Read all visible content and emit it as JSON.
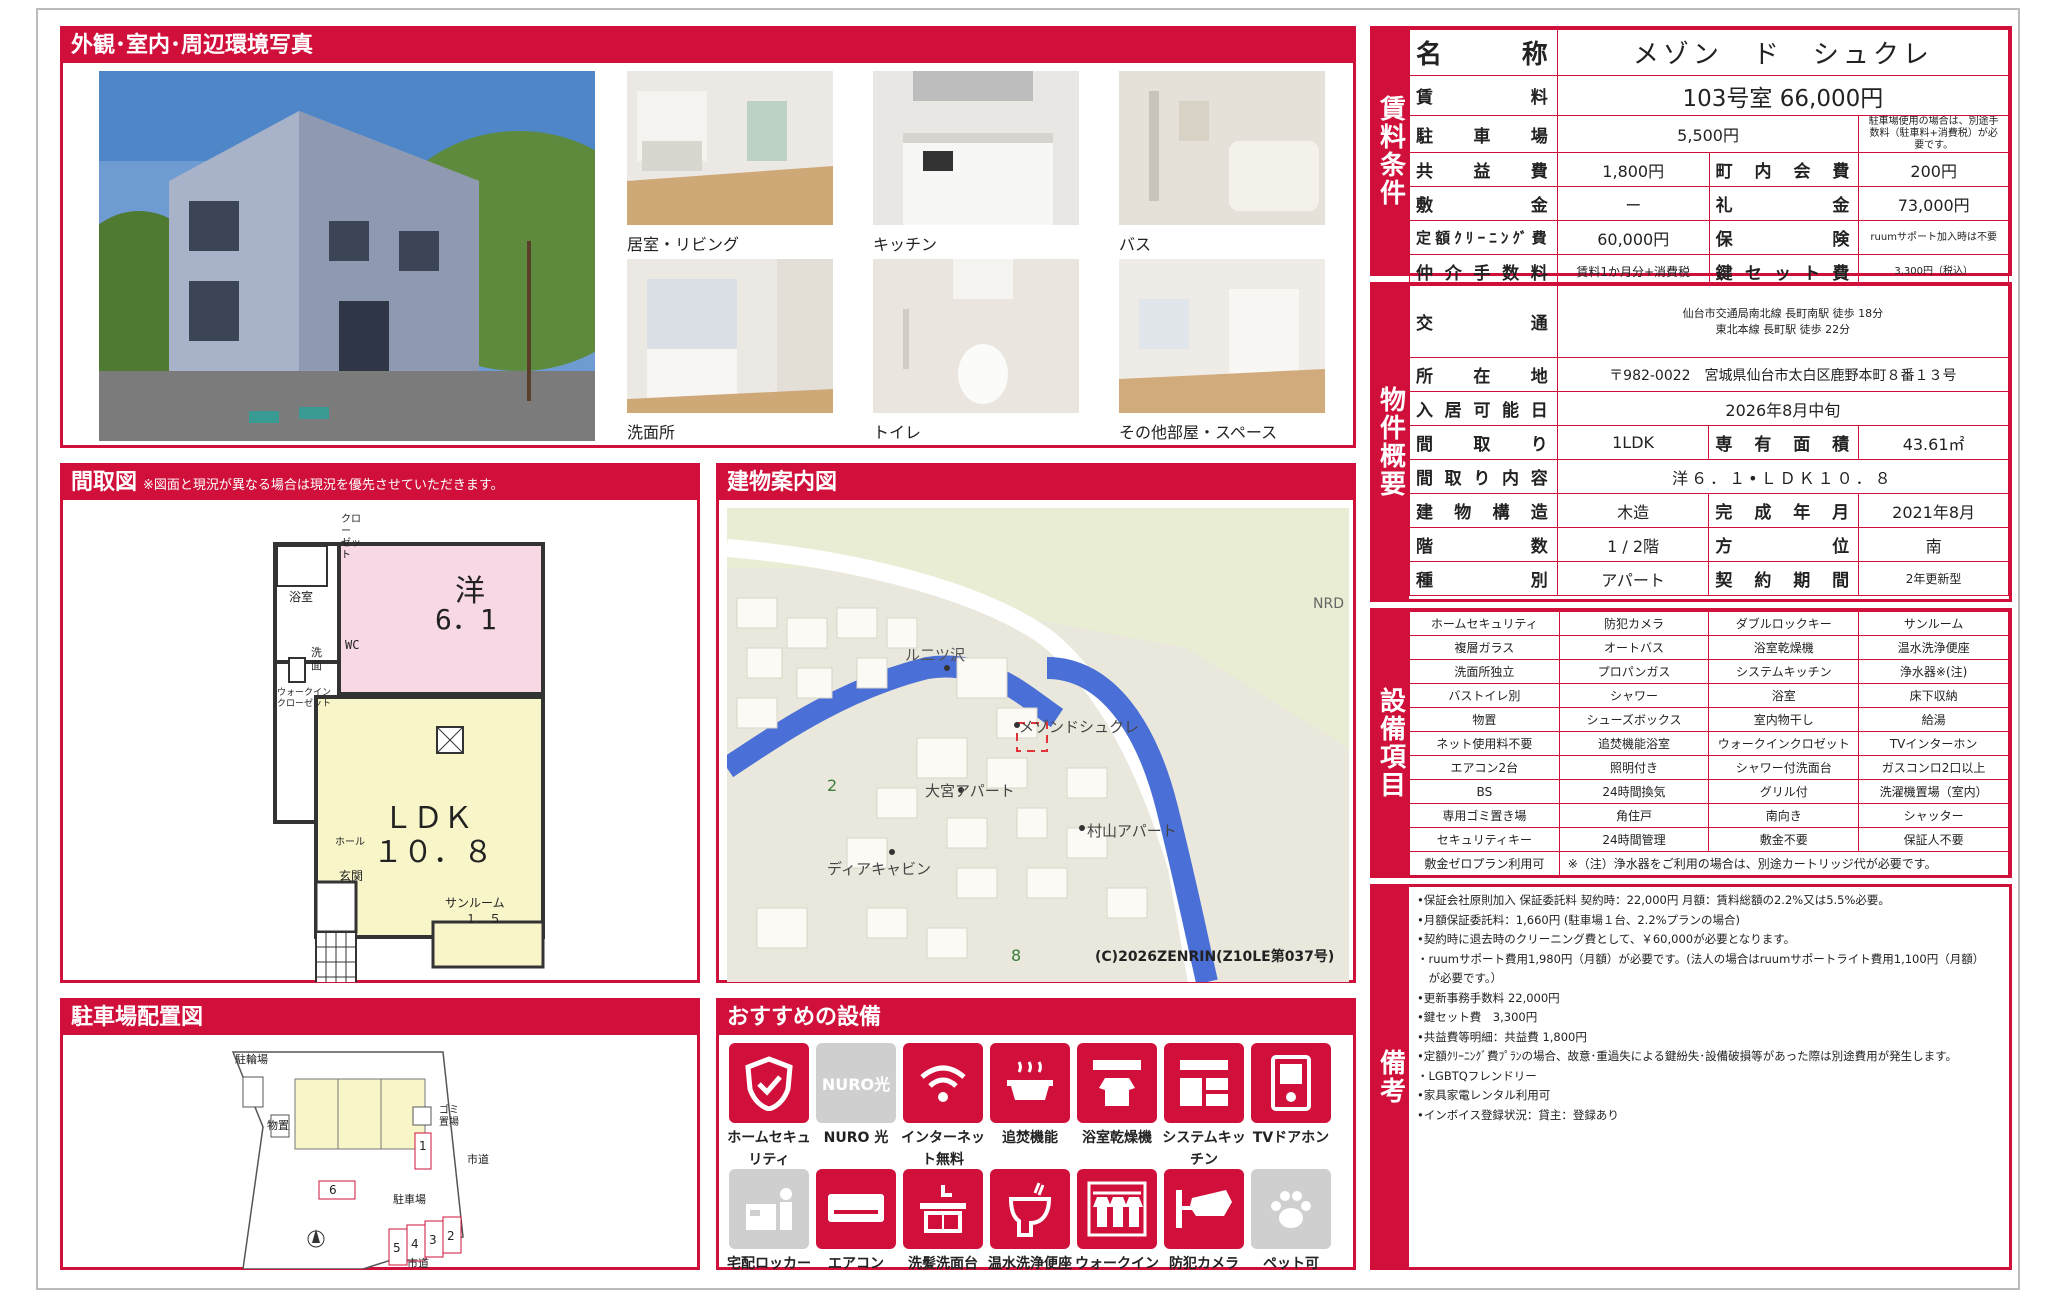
{
  "photos": {
    "header": "外観･室内･周辺環境写真",
    "captions": [
      "居室・リビング",
      "キッチン",
      "バス",
      "洗面所",
      "トイレ",
      "その他部屋・スペース"
    ]
  },
  "floorplan": {
    "header": "間取図",
    "note": "※図面と現況が異なる場合は現況を優先させていただきます。",
    "rooms": {
      "western": "洋",
      "western_size": "6．1",
      "ldk": "ＬＤＫ",
      "ldk_size": "１０．８",
      "bath": "浴室",
      "closet": "クロー ゼット",
      "washroom": "洗面",
      "wc": "WC",
      "walkin": "ウォークイン クローゼット",
      "hall": "ホール",
      "entrance": "玄関",
      "sunroom": "サンルーム",
      "sunroom_size": "１．５"
    }
  },
  "map": {
    "header": "建物案内図",
    "labels": [
      "ル二ツ沢",
      "メゾンドシュクレ",
      "大宮アパート",
      "村山アパート",
      "ディアキャビン",
      "2",
      "8",
      "NRD"
    ],
    "copyright": "(C)2026ZENRIN(Z10LE第037号)"
  },
  "parking": {
    "header": "駐車場配置図",
    "labels": {
      "bike": "駐輪場",
      "storage": "物置",
      "garbage": "ゴミ置場",
      "road1": "市道",
      "road2": "市道",
      "parking": "駐車場"
    },
    "spots": [
      "1",
      "2",
      "3",
      "4",
      "5",
      "6"
    ]
  },
  "equipment_icons": {
    "header": "おすすめの設備",
    "items": [
      {
        "label": "ホームセキュリティ",
        "state": "on"
      },
      {
        "label": "NURO 光",
        "state": "off",
        "icon_text": "NURO光"
      },
      {
        "label": "インターネット無料",
        "state": "on"
      },
      {
        "label": "追焚機能",
        "state": "on"
      },
      {
        "label": "浴室乾燥機",
        "state": "on"
      },
      {
        "label": "システムキッチン",
        "state": "on"
      },
      {
        "label": "TVドアホン",
        "state": "on"
      },
      {
        "label": "宅配ロッカー",
        "state": "off"
      },
      {
        "label": "エアコン",
        "state": "on"
      },
      {
        "label": "洗髪洗面台",
        "state": "on"
      },
      {
        "label": "温水洗浄便座",
        "state": "on"
      },
      {
        "label": "ウォークインクローゼット",
        "state": "on"
      },
      {
        "label": "防犯カメラ",
        "state": "on"
      },
      {
        "label": "ペット可",
        "state": "off"
      }
    ]
  },
  "rent": {
    "label": "賃料条件",
    "name_k": "名　称",
    "name": "メゾン　ド　シュクレ",
    "rent_k": "賃　料",
    "rent": "103号室 66,000円",
    "parking_k": "駐車場",
    "parking": "5,500円",
    "parking_note": "駐車場使用の場合は、別途手数料（駐車料+消費税）が必要です。",
    "common_k": "共益費",
    "common": "1,800円",
    "town_k": "町内会費",
    "town": "200円",
    "deposit_k": "敷金",
    "deposit": "ー",
    "key_money_k": "礼金",
    "key_money": "73,000円",
    "cleaning_k": "定額ｸﾘｰﾆﾝｸﾞ費",
    "cleaning": "60,000円",
    "insurance_k": "保険",
    "insurance": "ruumサポート加入時は不要",
    "broker_k": "仲介手数料",
    "broker": "賃料1か月分+消費税",
    "keyset_k": "鍵セット費",
    "keyset": "3,300円（税込）"
  },
  "property": {
    "label": "物件概要",
    "access_k": "交通",
    "access1": "仙台市交通局南北線 長町南駅 徒歩 18分",
    "access2": "東北本線 長町駅 徒歩 22分",
    "address_k": "所在地",
    "address": "〒982-0022　宮城県仙台市太白区鹿野本町８番１３号",
    "movein_k": "入居可能日",
    "movein": "2026年8月中旬",
    "layout_k": "間取り",
    "layout": "1LDK",
    "area_k": "専有面積",
    "area": "43.61㎡",
    "detail_k": "間取り内容",
    "detail": "洋６．１•ＬＤＫ１０．８",
    "structure_k": "建物構造",
    "structure": "木造",
    "built_k": "完成年月",
    "built": "2021年8月",
    "floor_k": "階数",
    "floor": "1 / 2階",
    "direction_k": "方位",
    "direction": "南",
    "type_k": "種別",
    "type": "アパート",
    "contract_k": "契約期間",
    "contract": "2年更新型"
  },
  "facilities": {
    "label": "設備項目",
    "rows": [
      [
        "ホームセキュリティ",
        "防犯カメラ",
        "ダブルロックキー",
        "サンルーム"
      ],
      [
        "複層ガラス",
        "オートバス",
        "浴室乾燥機",
        "温水洗浄便座"
      ],
      [
        "洗面所独立",
        "プロパンガス",
        "システムキッチン",
        "浄水器※(注)"
      ],
      [
        "バストイレ別",
        "シャワー",
        "浴室",
        "床下収納"
      ],
      [
        "物置",
        "シューズボックス",
        "室内物干し",
        "給湯"
      ],
      [
        "ネット使用料不要",
        "追焚機能浴室",
        "ウォークインクロゼット",
        "TVインターホン"
      ],
      [
        "エアコン2台",
        "照明付き",
        "シャワー付洗面台",
        "ガスコンロ2口以上"
      ],
      [
        "BS",
        "24時間換気",
        "グリル付",
        "洗濯機置場（室内）"
      ],
      [
        "専用ゴミ置き場",
        "角住戸",
        "南向き",
        "シャッター"
      ],
      [
        "セキュリティキー",
        "24時間管理",
        "敷金不要",
        "保証人不要"
      ]
    ],
    "last_k": "敷金ゼロプラン利用可",
    "last_note": "※（注）浄水器をご利用の場合は、別途カートリッジ代が必要です。"
  },
  "remarks": {
    "label": "備考",
    "lines": [
      "•保証会社原則加入 保証委託料 契約時：22,000円 月額：賃料総額の2.2%又は5.5%必要。",
      "•月額保証委託料：1,660円 (駐車場１台、2.2%プランの場合)",
      "•契約時に退去時のクリーニング費として、￥60,000が必要となります。",
      "・ruumサポート費用1,980円（月額）が必要です。(法人の場合はruumサポートライト費用1,100円（月額）",
      "　が必要です。）",
      "•更新事務手数料 22,000円",
      "•鍵セット費　3,300円",
      "•共益費等明細：共益費 1,800円",
      "•定額ｸﾘｰﾆﾝｸﾞ費ﾌﾟﾗﾝの場合、故意･重過失による鍵紛失･設備破損等があった際は別途費用が発生します。",
      "・LGBTQフレンドリー",
      "•家具家電レンタル利用可",
      "•インボイス登録状況：貸主：登録あり"
    ]
  },
  "colors": {
    "brand": "#d0103a",
    "gray_icon": "#cfcfcf"
  }
}
